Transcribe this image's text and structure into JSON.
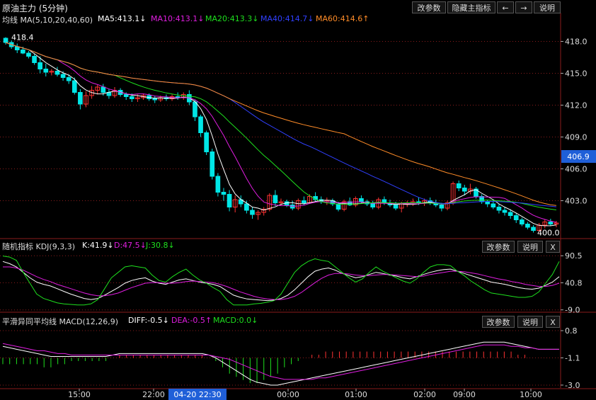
{
  "header": {
    "title": "原油主力 (5分钟)",
    "buttons": {
      "params": "改参数",
      "hide": "隐藏主指标",
      "explain": "说明"
    }
  },
  "colors": {
    "ma5": "#ffffff",
    "ma10": "#e01ee0",
    "ma20": "#1ee01e",
    "ma40": "#3040ff",
    "ma60": "#ff8c28",
    "candle_up": "#ff3232",
    "candle_down": "#00e6e6",
    "grid": "#8a1c1c"
  },
  "ma_legend": {
    "label": "均线 MA(5,10,20,40,60)",
    "ma5": "MA5:413.1↓",
    "ma10": "MA10:413.1↓",
    "ma20": "MA20:413.3↓",
    "ma40": "MA40:414.7↓",
    "ma60": "MA60:414.6↑"
  },
  "kdj_legend": {
    "label": "随机指标 KDJ(9,3,3)",
    "k": "K:41.9↓",
    "d": "D:47.5↓",
    "j": "J:30.8↓",
    "params": "改参数",
    "explain": "说明",
    "close": "X"
  },
  "macd_legend": {
    "label": "平滑异同平均线 MACD(12,26,9)",
    "diff": "DIFF:-0.5↓",
    "dea": "DEA:-0.5↑",
    "macd": "MACD:0.0↓",
    "params": "改参数",
    "explain": "说明",
    "close": "X"
  },
  "price_tag": "406.9",
  "chart_data": [
    {
      "type": "candlestick",
      "title": "原油主力 (5分钟)",
      "y_ticks": [
        "418.0",
        "415.0",
        "412.0",
        "409.0",
        "406.0",
        "403.0"
      ],
      "ylim": [
        399.5,
        419.5
      ],
      "annotations": {
        "high": "418.4",
        "low": "400.0"
      },
      "ohlc": [
        [
          418.3,
          418.4,
          417.7,
          417.9
        ],
        [
          417.9,
          418.1,
          417.3,
          417.5
        ],
        [
          417.5,
          417.8,
          416.9,
          417.2
        ],
        [
          417.2,
          417.5,
          416.8,
          416.9
        ],
        [
          416.9,
          417.1,
          416.4,
          416.6
        ],
        [
          416.6,
          416.8,
          415.8,
          416.0
        ],
        [
          416.0,
          416.6,
          415.0,
          415.4
        ],
        [
          415.4,
          415.9,
          414.7,
          415.1
        ],
        [
          415.1,
          415.4,
          414.8,
          415.2
        ],
        [
          415.2,
          415.6,
          414.7,
          414.9
        ],
        [
          414.9,
          415.2,
          414.3,
          414.6
        ],
        [
          414.6,
          414.9,
          414.0,
          414.3
        ],
        [
          414.3,
          414.6,
          413.0,
          413.2
        ],
        [
          413.2,
          413.5,
          411.6,
          412.1
        ],
        [
          412.1,
          413.3,
          411.8,
          412.9
        ],
        [
          412.9,
          413.8,
          412.6,
          413.4
        ],
        [
          413.4,
          413.9,
          413.0,
          413.7
        ],
        [
          413.7,
          414.0,
          412.9,
          413.2
        ],
        [
          413.2,
          413.5,
          412.6,
          412.9
        ],
        [
          412.9,
          413.7,
          412.7,
          413.4
        ],
        [
          413.4,
          413.6,
          412.8,
          413.0
        ],
        [
          413.0,
          413.2,
          412.5,
          412.8
        ],
        [
          412.8,
          413.1,
          412.3,
          412.6
        ],
        [
          412.6,
          413.0,
          412.3,
          412.7
        ],
        [
          412.7,
          413.1,
          412.5,
          412.9
        ],
        [
          412.9,
          413.1,
          412.4,
          412.6
        ],
        [
          412.6,
          412.9,
          412.2,
          412.5
        ],
        [
          412.5,
          412.9,
          412.3,
          412.7
        ],
        [
          412.7,
          413.0,
          412.4,
          412.6
        ],
        [
          412.6,
          413.0,
          412.4,
          412.8
        ],
        [
          412.8,
          413.2,
          412.5,
          412.7
        ],
        [
          412.7,
          413.2,
          412.5,
          413.0
        ],
        [
          413.0,
          413.4,
          412.0,
          412.3
        ],
        [
          412.3,
          412.5,
          410.5,
          410.9
        ],
        [
          410.9,
          411.1,
          409.0,
          409.4
        ],
        [
          409.4,
          409.6,
          407.3,
          407.6
        ],
        [
          407.6,
          407.9,
          405.0,
          405.3
        ],
        [
          405.3,
          405.6,
          403.4,
          403.8
        ],
        [
          403.8,
          404.2,
          403.0,
          403.6
        ],
        [
          403.6,
          404.0,
          402.0,
          402.4
        ],
        [
          402.4,
          403.5,
          401.9,
          403.1
        ],
        [
          403.1,
          403.5,
          402.4,
          402.7
        ],
        [
          402.7,
          403.0,
          401.8,
          402.1
        ],
        [
          402.1,
          402.4,
          401.3,
          401.7
        ],
        [
          401.7,
          402.1,
          401.2,
          401.9
        ],
        [
          401.9,
          402.4,
          401.6,
          402.2
        ],
        [
          402.2,
          403.7,
          402.0,
          403.5
        ],
        [
          403.5,
          404.0,
          402.5,
          402.8
        ],
        [
          402.8,
          403.2,
          402.5,
          402.9
        ],
        [
          402.9,
          403.1,
          402.4,
          402.6
        ],
        [
          402.6,
          403.0,
          402.1,
          402.3
        ],
        [
          402.3,
          403.2,
          402.1,
          403.0
        ],
        [
          403.0,
          403.4,
          402.6,
          402.8
        ],
        [
          402.8,
          403.6,
          402.7,
          403.4
        ],
        [
          403.4,
          403.8,
          402.9,
          403.1
        ],
        [
          403.1,
          403.4,
          402.7,
          402.9
        ],
        [
          402.9,
          403.3,
          402.6,
          403.0
        ],
        [
          403.0,
          403.2,
          402.5,
          402.7
        ],
        [
          402.7,
          402.9,
          402.0,
          402.2
        ],
        [
          402.2,
          403.1,
          402.0,
          402.9
        ],
        [
          402.9,
          403.3,
          402.5,
          402.6
        ],
        [
          402.6,
          403.4,
          402.4,
          403.2
        ],
        [
          403.2,
          403.5,
          402.8,
          402.9
        ],
        [
          402.9,
          403.1,
          402.5,
          402.7
        ],
        [
          402.7,
          403.0,
          402.2,
          402.4
        ],
        [
          402.4,
          403.3,
          402.2,
          403.1
        ],
        [
          403.1,
          403.4,
          402.6,
          402.8
        ],
        [
          402.8,
          403.1,
          402.4,
          402.6
        ],
        [
          402.6,
          402.9,
          402.1,
          402.3
        ],
        [
          402.3,
          402.9,
          401.9,
          402.7
        ],
        [
          402.7,
          403.0,
          402.4,
          402.8
        ],
        [
          402.8,
          403.2,
          402.5,
          402.9
        ],
        [
          402.9,
          403.3,
          402.6,
          402.8
        ],
        [
          402.8,
          403.2,
          402.5,
          403.0
        ],
        [
          403.0,
          403.3,
          402.6,
          402.8
        ],
        [
          402.8,
          403.1,
          402.4,
          402.6
        ],
        [
          402.6,
          402.8,
          402.0,
          402.3
        ],
        [
          402.3,
          403.0,
          402.1,
          402.8
        ],
        [
          402.8,
          404.8,
          402.6,
          404.6
        ],
        [
          404.6,
          404.9,
          403.9,
          404.2
        ],
        [
          404.2,
          404.5,
          403.5,
          403.9
        ],
        [
          403.9,
          404.6,
          403.6,
          404.1
        ],
        [
          404.1,
          404.3,
          403.2,
          403.4
        ],
        [
          403.4,
          403.6,
          402.7,
          402.9
        ],
        [
          402.9,
          403.1,
          402.4,
          402.7
        ],
        [
          402.7,
          403.0,
          402.2,
          402.4
        ],
        [
          402.4,
          402.7,
          401.8,
          402.1
        ],
        [
          402.1,
          402.4,
          401.6,
          401.9
        ],
        [
          401.9,
          402.2,
          401.3,
          401.6
        ],
        [
          401.6,
          401.8,
          400.9,
          401.2
        ],
        [
          401.2,
          401.4,
          400.6,
          400.8
        ],
        [
          400.8,
          401.0,
          400.3,
          400.5
        ],
        [
          400.5,
          400.7,
          400.0,
          400.2
        ],
        [
          400.2,
          400.9,
          400.0,
          400.7
        ],
        [
          400.7,
          401.2,
          400.4,
          401.0
        ],
        [
          401.0,
          401.3,
          400.6,
          400.8
        ],
        [
          400.8,
          401.1,
          400.5,
          400.9
        ]
      ]
    },
    {
      "type": "line",
      "title": "随机指标 KDJ(9,3,3)",
      "y_ticks": [
        "90.5",
        "40.8",
        "-9.0"
      ],
      "ylim": [
        -12,
        96
      ],
      "series": [
        {
          "name": "K",
          "values": [
            80,
            76,
            70,
            60,
            50,
            42,
            38,
            35,
            30,
            25,
            20,
            16,
            12,
            10,
            12,
            18,
            25,
            32,
            40,
            45,
            48,
            50,
            44,
            40,
            38,
            42,
            46,
            48,
            45,
            42,
            40,
            38,
            34,
            26,
            18,
            14,
            11,
            10,
            9,
            8,
            9,
            12,
            18,
            28,
            40,
            52,
            62,
            66,
            68,
            64,
            58,
            54,
            50,
            52,
            56,
            60,
            58,
            55,
            53,
            50,
            48,
            52,
            56,
            60,
            63,
            65,
            66,
            62,
            58,
            54,
            50,
            46,
            42,
            40,
            38,
            35,
            32,
            30,
            29,
            31,
            36,
            42,
            52
          ]
        },
        {
          "name": "D",
          "values": [
            70,
            70,
            68,
            64,
            58,
            52,
            47,
            43,
            38,
            34,
            30,
            26,
            22,
            19,
            17,
            17,
            19,
            22,
            27,
            32,
            36,
            40,
            41,
            41,
            40,
            40,
            41,
            43,
            44,
            43,
            42,
            41,
            38,
            34,
            29,
            24,
            20,
            16,
            13,
            11,
            10,
            10,
            12,
            16,
            23,
            32,
            41,
            49,
            55,
            58,
            58,
            57,
            55,
            54,
            54,
            55,
            56,
            56,
            55,
            54,
            53,
            52,
            53,
            56,
            58,
            60,
            62,
            62,
            61,
            59,
            57,
            54,
            51,
            48,
            46,
            43,
            41,
            38,
            36,
            34,
            34,
            36,
            40
          ]
        },
        {
          "name": "J",
          "values": [
            90,
            88,
            82,
            60,
            40,
            20,
            12,
            8,
            4,
            2,
            1,
            0,
            0,
            2,
            10,
            30,
            50,
            60,
            70,
            72,
            70,
            68,
            55,
            45,
            42,
            52,
            60,
            66,
            55,
            46,
            40,
            32,
            25,
            10,
            0,
            0,
            0,
            2,
            3,
            5,
            8,
            20,
            40,
            60,
            72,
            80,
            85,
            82,
            80,
            70,
            60,
            50,
            42,
            48,
            60,
            70,
            62,
            56,
            50,
            44,
            40,
            48,
            60,
            70,
            74,
            74,
            72,
            62,
            54,
            44,
            36,
            28,
            22,
            20,
            18,
            16,
            14,
            14,
            16,
            24,
            40,
            56,
            80
          ]
        }
      ]
    },
    {
      "type": "bar+line",
      "title": "平滑异同平均线 MACD(12,26,9)",
      "y_ticks": [
        "0.8",
        "-1.1",
        "-3.0"
      ],
      "ylim": [
        -3.2,
        1.0
      ],
      "x_ticks": [
        "15:00",
        "22:00",
        "00:00",
        "01:00",
        "02:00",
        "09:00",
        "10:00"
      ],
      "x_highlight": "04-20 22:30",
      "series": [
        {
          "name": "DIFF",
          "values": [
            -0.3,
            -0.4,
            -0.5,
            -0.6,
            -0.7,
            -0.8,
            -0.9,
            -1.0,
            -1.0,
            -1.0,
            -1.0,
            -1.0,
            -1.0,
            -1.0,
            -1.0,
            -1.0,
            -0.9,
            -0.8,
            -0.8,
            -0.8,
            -0.8,
            -0.8,
            -0.8,
            -0.8,
            -0.8,
            -0.8,
            -0.8,
            -0.8,
            -0.8,
            -0.8,
            -0.9,
            -1.1,
            -1.4,
            -1.7,
            -2.0,
            -2.3,
            -2.6,
            -2.8,
            -2.9,
            -3.0,
            -3.0,
            -2.9,
            -2.8,
            -2.7,
            -2.6,
            -2.5,
            -2.4,
            -2.3,
            -2.2,
            -2.1,
            -2.0,
            -1.9,
            -1.8,
            -1.7,
            -1.6,
            -1.5,
            -1.4,
            -1.3,
            -1.2,
            -1.1,
            -1.0,
            -0.9,
            -0.8,
            -0.7,
            -0.6,
            -0.5,
            -0.4,
            -0.3,
            -0.2,
            -0.1,
            0.0,
            0.0,
            0.0,
            0.0,
            -0.1,
            -0.2,
            -0.3,
            -0.4,
            -0.5,
            -0.5,
            -0.5,
            -0.5
          ]
        },
        {
          "name": "DEA",
          "values": [
            -0.1,
            -0.2,
            -0.3,
            -0.4,
            -0.5,
            -0.6,
            -0.6,
            -0.7,
            -0.8,
            -0.8,
            -0.9,
            -0.9,
            -0.9,
            -0.9,
            -0.9,
            -0.9,
            -0.9,
            -0.9,
            -0.9,
            -0.9,
            -0.9,
            -0.9,
            -0.9,
            -0.9,
            -0.9,
            -0.9,
            -0.9,
            -0.9,
            -0.9,
            -0.9,
            -0.9,
            -1.0,
            -1.1,
            -1.2,
            -1.4,
            -1.6,
            -1.8,
            -2.0,
            -2.2,
            -2.4,
            -2.5,
            -2.6,
            -2.6,
            -2.6,
            -2.6,
            -2.6,
            -2.5,
            -2.5,
            -2.4,
            -2.3,
            -2.2,
            -2.1,
            -2.0,
            -1.9,
            -1.8,
            -1.7,
            -1.6,
            -1.5,
            -1.4,
            -1.3,
            -1.2,
            -1.1,
            -1.0,
            -0.9,
            -0.8,
            -0.7,
            -0.6,
            -0.5,
            -0.4,
            -0.3,
            -0.2,
            -0.2,
            -0.2,
            -0.2,
            -0.3,
            -0.3,
            -0.4,
            -0.4,
            -0.5,
            -0.5,
            -0.5,
            -0.5
          ]
        }
      ]
    }
  ]
}
